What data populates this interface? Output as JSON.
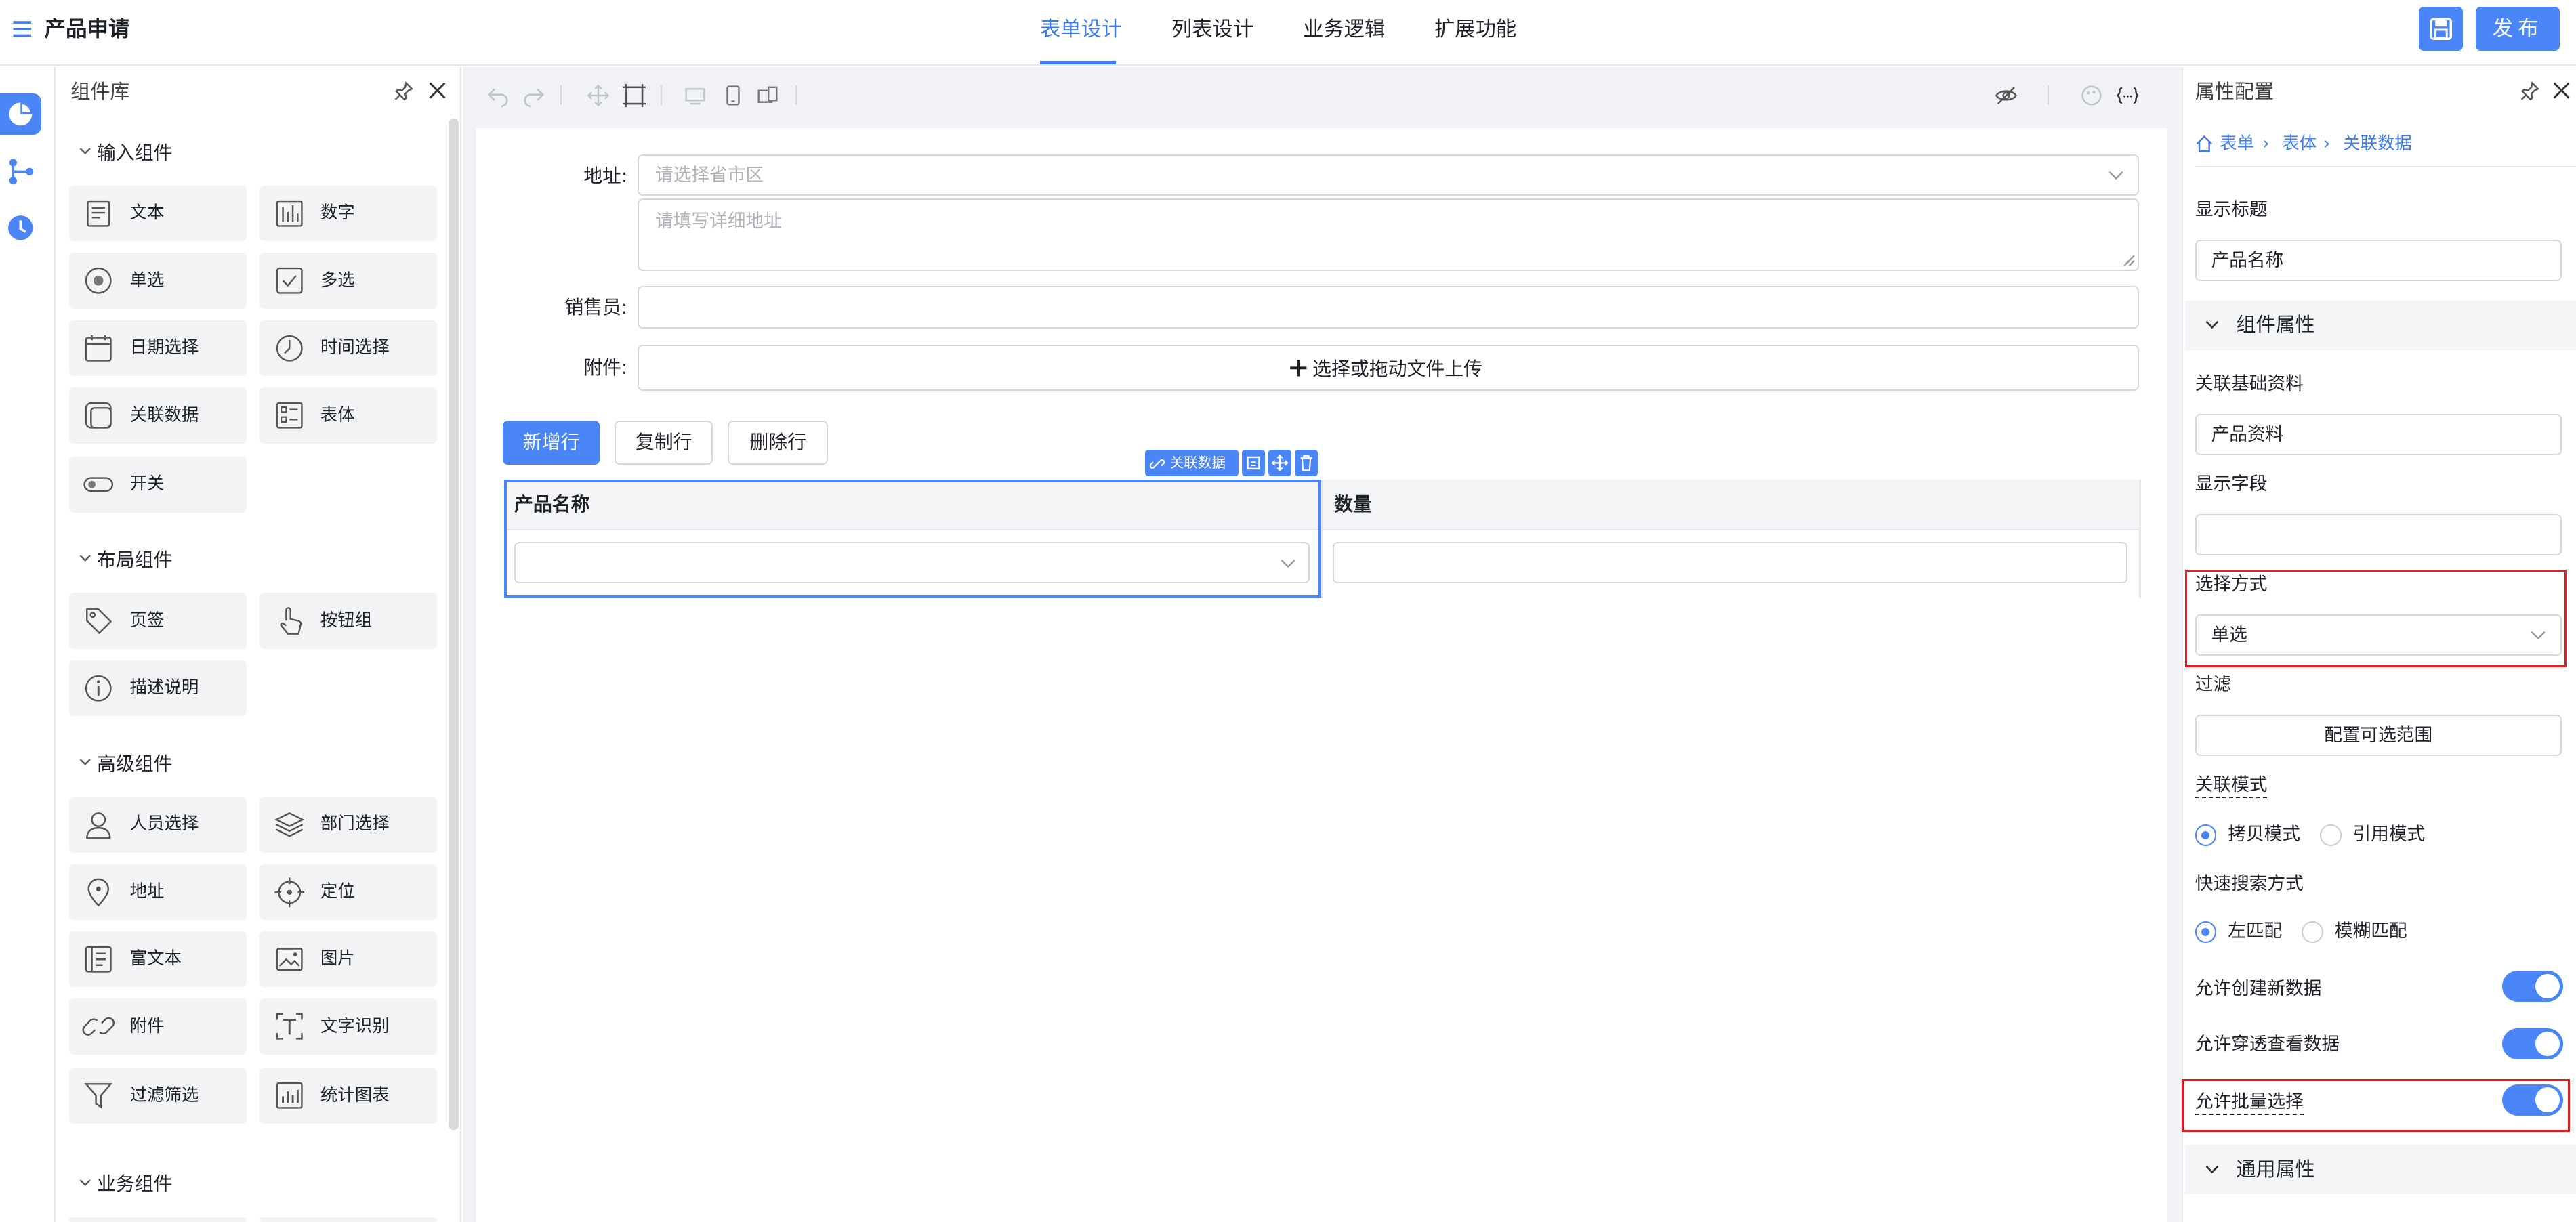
{
  "header": {
    "title": "产品申请",
    "tabs": [
      {
        "label": "表单设计",
        "active": true
      },
      {
        "label": "列表设计",
        "active": false
      },
      {
        "label": "业务逻辑",
        "active": false
      },
      {
        "label": "扩展功能",
        "active": false
      }
    ],
    "publish_label": "发布",
    "accent": "#3d7cf2"
  },
  "library": {
    "title": "组件库",
    "sections": [
      {
        "title": "输入组件",
        "items": [
          {
            "label": "文本",
            "icon": "text-icon"
          },
          {
            "label": "数字",
            "icon": "number-icon"
          },
          {
            "label": "单选",
            "icon": "radio-icon"
          },
          {
            "label": "多选",
            "icon": "checkbox-icon"
          },
          {
            "label": "日期选择",
            "icon": "calendar-icon"
          },
          {
            "label": "时间选择",
            "icon": "clock-icon"
          },
          {
            "label": "关联数据",
            "icon": "relation-icon"
          },
          {
            "label": "表体",
            "icon": "table-icon"
          },
          {
            "label": "开关",
            "icon": "switch-icon"
          }
        ]
      },
      {
        "title": "布局组件",
        "items": [
          {
            "label": "页签",
            "icon": "tag-icon"
          },
          {
            "label": "按钮组",
            "icon": "pointer-icon"
          },
          {
            "label": "描述说明",
            "icon": "info-icon"
          }
        ]
      },
      {
        "title": "高级组件",
        "items": [
          {
            "label": "人员选择",
            "icon": "user-icon"
          },
          {
            "label": "部门选择",
            "icon": "layers-icon"
          },
          {
            "label": "地址",
            "icon": "location-pin-icon"
          },
          {
            "label": "定位",
            "icon": "crosshair-icon"
          },
          {
            "label": "富文本",
            "icon": "rich-text-icon"
          },
          {
            "label": "图片",
            "icon": "image-icon"
          },
          {
            "label": "附件",
            "icon": "link-icon"
          },
          {
            "label": "文字识别",
            "icon": "ocr-icon"
          },
          {
            "label": "过滤筛选",
            "icon": "filter-icon"
          },
          {
            "label": "统计图表",
            "icon": "bar-chart-icon"
          }
        ]
      },
      {
        "title": "业务组件",
        "items": []
      }
    ]
  },
  "form": {
    "address_label": "地址:",
    "address_region_placeholder": "请选择省市区",
    "address_detail_placeholder": "请填写详细地址",
    "salesperson_label": "销售员:",
    "attachment_label": "附件:",
    "upload_label": "选择或拖动文件上传",
    "row_buttons": {
      "add": "新增行",
      "copy": "复制行",
      "delete": "删除行"
    },
    "selected_tag": "关联数据",
    "table_columns": [
      "产品名称",
      "数量"
    ]
  },
  "properties": {
    "title": "属性配置",
    "breadcrumb": [
      "表单",
      "表体",
      "关联数据"
    ],
    "display_title_label": "显示标题",
    "display_title_value": "产品名称",
    "component_group": "组件属性",
    "link_base_label": "关联基础资料",
    "link_base_value": "产品资料",
    "display_field_label": "显示字段",
    "display_field_value": "",
    "select_mode_label": "选择方式",
    "select_mode_value": "单选",
    "filter_label": "过滤",
    "filter_button": "配置可选范围",
    "link_mode_label": "关联模式",
    "link_mode_options": [
      "拷贝模式",
      "引用模式"
    ],
    "link_mode_selected": "拷贝模式",
    "search_mode_label": "快速搜索方式",
    "search_mode_options": [
      "左匹配",
      "模糊匹配"
    ],
    "search_mode_selected": "左匹配",
    "toggles": [
      {
        "label": "允许创建新数据",
        "on": true
      },
      {
        "label": "允许穿透查看数据",
        "on": true
      },
      {
        "label": "允许批量选择",
        "on": true
      }
    ],
    "general_group": "通用属性"
  }
}
